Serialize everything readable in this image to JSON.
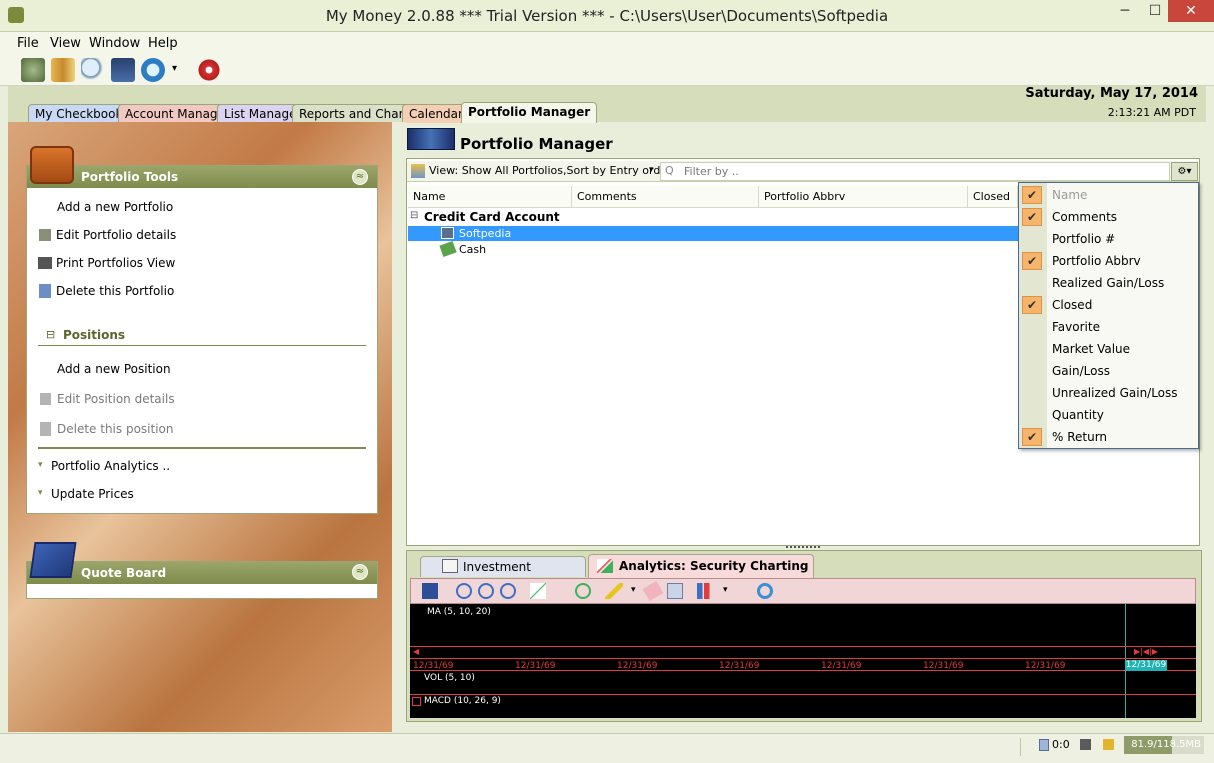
{
  "window": {
    "title": "My Money 2.0.88 *** Trial Version *** - C:\\Users\\User\\Documents\\Softpedia",
    "minimize": "─",
    "restore": "☐",
    "close": "✕"
  },
  "menu": [
    "File",
    "View",
    "Window",
    "Help"
  ],
  "toolbar": {
    "icons": [
      "globe-icon",
      "books-icon",
      "magnifier-icon",
      "chart-icon",
      "clock-icon",
      "dropdown-arrow-icon",
      "gear-icon"
    ],
    "dropdown_arrow": "▾"
  },
  "tabs": [
    {
      "label": "My Checkbook",
      "color": "#c9d9f3"
    },
    {
      "label": "Account Manager",
      "color": "#f2c9c1"
    },
    {
      "label": "List Manager",
      "color": "#dcd3f0"
    },
    {
      "label": "Reports and Charts",
      "color": "#dbe0c8"
    },
    {
      "label": "Calendar",
      "color": "#f4cfb3"
    },
    {
      "label": "Portfolio Manager",
      "color": "#f4f6ea"
    }
  ],
  "header": {
    "date": "Saturday, May 17, 2014",
    "time": "2:13:21 AM PDT"
  },
  "portfolio_tools": {
    "title": "Portfolio Tools",
    "collapse": "≈",
    "links": [
      "Add a new Portfolio",
      "Edit Portfolio details",
      "Print Portfolios View",
      "Delete this Portfolio"
    ],
    "positions_title": "Positions",
    "positions_toggle": "⊟",
    "position_links": [
      "Add a new Position",
      "Edit Position details",
      "Delete this position"
    ],
    "extra_links": [
      "Portfolio Analytics ..",
      "Update Prices"
    ],
    "expand_arrow": "▾"
  },
  "quote_board": {
    "title": "Quote Board",
    "collapse": "≈"
  },
  "portfolio_manager": {
    "title": "Portfolio Manager",
    "view_label": "View: Show All Portfolios,Sort by Entry order",
    "view_arrow": "▾",
    "filter_placeholder": "Filter by ..",
    "search_glyph": "Q",
    "settings_glyph": "⚙▾",
    "columns": [
      "Name",
      "Comments",
      "Portfolio Abbrv",
      "Closed"
    ],
    "group": "Credit Card Account",
    "group_toggle": "⊟",
    "rows": [
      "Softpedia",
      "Cash"
    ]
  },
  "column_chooser": {
    "check_glyph": "✔",
    "items": [
      {
        "label": "Name",
        "checked": true,
        "disabled": true
      },
      {
        "label": "Comments",
        "checked": true,
        "disabled": false
      },
      {
        "label": "Portfolio #",
        "checked": false,
        "disabled": false
      },
      {
        "label": "Portfolio Abbrv",
        "checked": true,
        "disabled": false
      },
      {
        "label": "Realized Gain/Loss",
        "checked": false,
        "disabled": false
      },
      {
        "label": "Closed",
        "checked": true,
        "disabled": false
      },
      {
        "label": "Favorite",
        "checked": false,
        "disabled": false
      },
      {
        "label": "Market Value",
        "checked": false,
        "disabled": false
      },
      {
        "label": "Gain/Loss",
        "checked": false,
        "disabled": false
      },
      {
        "label": "Unrealized Gain/Loss",
        "checked": false,
        "disabled": false
      },
      {
        "label": "Quantity",
        "checked": false,
        "disabled": false
      },
      {
        "label": "% Return",
        "checked": true,
        "disabled": false
      }
    ]
  },
  "bottom_tabs": [
    "Investment Transactions",
    "Analytics: Security Charting Tools"
  ],
  "chart": {
    "ma_label": "MA (5, 10, 20)",
    "vol_label": "VOL (5, 10)",
    "macd_label": "MACD (10, 26, 9)",
    "dates": [
      "12/31/69",
      "12/31/69",
      "12/31/69",
      "12/31/69",
      "12/31/69",
      "12/31/69",
      "12/31/69",
      "12/31/69"
    ],
    "cursor_date": "12/31/69",
    "nav_left": "◀",
    "nav_right": "▶|◀|▶",
    "accent_color": "#e23b3b",
    "cursor_color": "#1fb3b3"
  },
  "statusbar": {
    "counter": "0:0",
    "memory": "81.9/118.5MB"
  }
}
